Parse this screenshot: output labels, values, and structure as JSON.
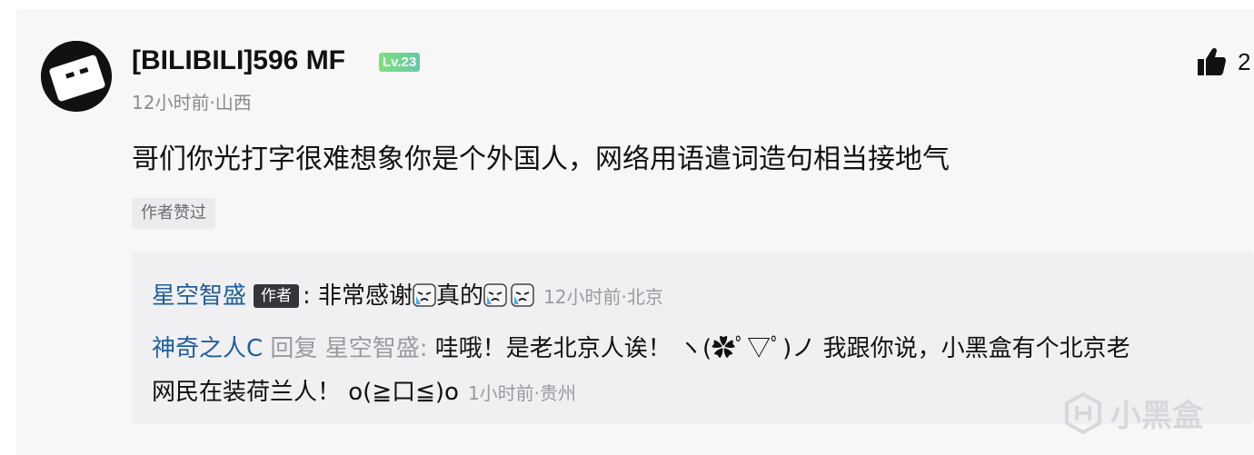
{
  "comment": {
    "username": "[BILIBILI]596 MF",
    "level": "Lv.23",
    "time_location": "12小时前·山西",
    "like_count": "2",
    "text": "哥们你光打字很难想象你是个外国人，网络用语遣词造句相当接地气",
    "author_liked_tag": "作者赞过"
  },
  "replies": [
    {
      "name": "星空智盛",
      "badge": "作者",
      "text_prefix": ": 非常感谢",
      "text_mid": "真的",
      "time_location": "12小时前·北京"
    },
    {
      "name": "神奇之人C",
      "reply_word": "回复",
      "reply_to": "星空智盛",
      "colon": ":",
      "text_line1": "哇哦！是老北京人诶！ ヽ(✿ﾟ▽ﾟ)ノ 我跟你说，小黑盒有个北京老",
      "text_line2": "网民在装荷兰人！ o(≧口≦)o",
      "time_location": "1小时前·贵州"
    }
  ],
  "watermark": "小黑盒",
  "colors": {
    "name_link": "#1f5f9e",
    "level_badge": "#7fe07a",
    "muted": "#9a9aa0"
  }
}
